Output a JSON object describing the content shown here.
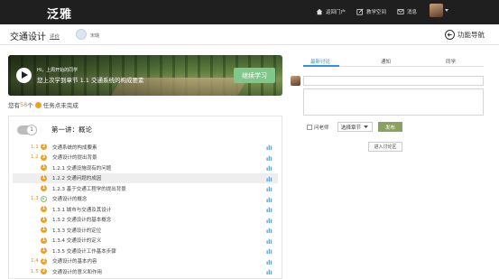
{
  "app": {
    "logo": "泛雅"
  },
  "topnav": {
    "items": [
      {
        "label": "返回门户"
      },
      {
        "label": "教学空间"
      },
      {
        "label": "消息"
      }
    ]
  },
  "header": {
    "course_title": "交通设计",
    "review_label": "评价",
    "teacher_name": "宋璐",
    "guide_label": "功能导航"
  },
  "banner": {
    "line1": "Hi，上周开始的同学",
    "line2": "您上次学到章节 1.1 交通系统的构成要素",
    "continue_label": "继续学习"
  },
  "progress": {
    "prefix": "您有",
    "count": "58",
    "unit": "个",
    "suffix": "任务点未完成"
  },
  "chapter": {
    "number": "1",
    "title": "第一讲：概论"
  },
  "rows": [
    {
      "idx": "1.1",
      "mark": "2",
      "label": "交通系统的构成要素"
    },
    {
      "idx": "1.2",
      "mark": "3",
      "label": "交通设计的提出背景"
    },
    {
      "idx": "",
      "mark": "1",
      "label": "1.2.1 交通设施现有的问题"
    },
    {
      "idx": "",
      "mark": "1",
      "label": "1.2.2 交通问题的成因"
    },
    {
      "idx": "",
      "mark": "1",
      "label": "1.2.3 基于交通工程学的提出背景"
    },
    {
      "idx": "1.3",
      "mark": "",
      "label": "交通设计的概念"
    },
    {
      "idx": "",
      "mark": "1",
      "label": "1.3.1 城市与交通及其设计"
    },
    {
      "idx": "",
      "mark": "1",
      "label": "1.3.2 交通设计的基本概念"
    },
    {
      "idx": "",
      "mark": "1",
      "label": "1.3.3 交通设计的定位"
    },
    {
      "idx": "",
      "mark": "1",
      "label": "1.3.4 交通设计的定义"
    },
    {
      "idx": "",
      "mark": "1",
      "label": "1.3.5 交通设计工作基本步骤"
    },
    {
      "idx": "1.4",
      "mark": "2",
      "label": "交通设计的基本内容"
    },
    {
      "idx": "1.5",
      "mark": "2",
      "label": "交通设计的意义和作用"
    }
  ],
  "right": {
    "tabs": [
      {
        "label": "最新讨论"
      },
      {
        "label": "通知"
      },
      {
        "label": "同学"
      }
    ],
    "ask_teacher": "问老师",
    "select_chapter": "选择章节",
    "publish": "发布",
    "enter_discussion": "进入讨论区"
  },
  "colors": {
    "accent_orange": "#f08a00",
    "green_button": "#7fc78a",
    "tab_blue": "#3b8fd6",
    "publish_green": "#8aa15f"
  }
}
